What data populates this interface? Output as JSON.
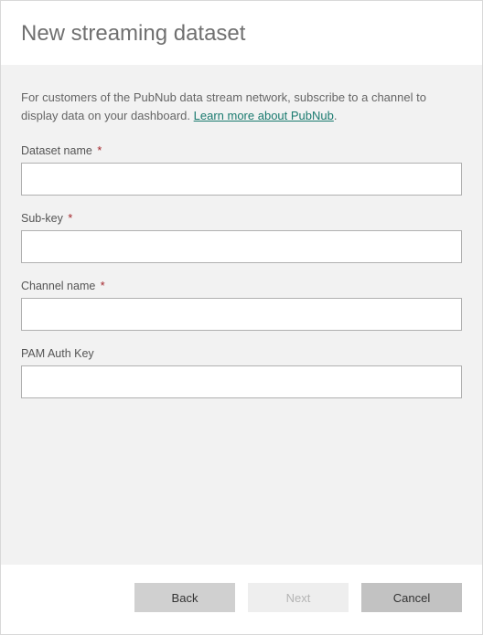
{
  "title": "New streaming dataset",
  "intro_text_before_link": "For customers of the PubNub data stream network, subscribe to a channel to display data on your dashboard. ",
  "intro_link_text": "Learn more about PubNub",
  "intro_text_after_link": ".",
  "fields": {
    "dataset_name": {
      "label": "Dataset name",
      "required": true,
      "value": ""
    },
    "sub_key": {
      "label": "Sub-key",
      "required": true,
      "value": ""
    },
    "channel_name": {
      "label": "Channel name",
      "required": true,
      "value": ""
    },
    "pam_auth_key": {
      "label": "PAM Auth Key",
      "required": false,
      "value": ""
    }
  },
  "required_marker": "*",
  "buttons": {
    "back": "Back",
    "next": "Next",
    "cancel": "Cancel"
  }
}
